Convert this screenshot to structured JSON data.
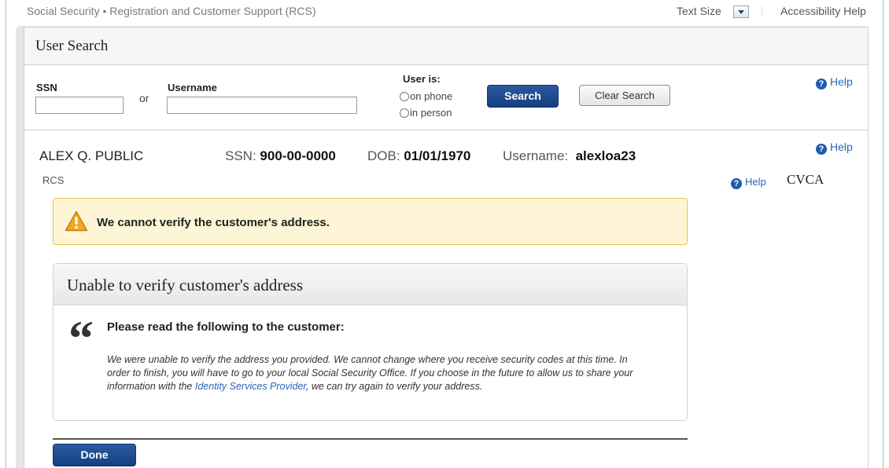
{
  "topbar": {
    "site_title": "Social Security • Registration and Customer Support (RCS)",
    "text_size_label": "Text Size",
    "accessibility_help": "Accessibility Help"
  },
  "user_search": {
    "title": "User Search",
    "ssn_label": "SSN",
    "ssn_value": "",
    "or_label": "or",
    "username_label": "Username",
    "username_value": "",
    "user_is_label": "User is:",
    "options": [
      "on phone",
      "in person"
    ],
    "search_button": "Search",
    "clear_button": "Clear Search",
    "help_label": "Help"
  },
  "customer": {
    "name": "ALEX Q. PUBLIC",
    "ssn_label": "SSN:",
    "ssn": "900-00-0000",
    "dob_label": "DOB:",
    "dob": "01/01/1970",
    "username_label": "Username:",
    "username": "alexloa23",
    "help_label": "Help"
  },
  "section": {
    "rcs_label": "RCS",
    "help_label": "Help",
    "cvca_label": "CVCA"
  },
  "alert": {
    "message": "We cannot verify the customer's address."
  },
  "panel": {
    "title": "Unable to verify customer's address",
    "quote_mark": "“",
    "read_label": "Please read the following to the customer:",
    "text_before_link": "We were unable to verify the address you provided. We cannot change where you receive security codes at this time. In order to finish, you will have to go to your local Social Security Office. If you choose in the future to allow us to share your information with the ",
    "link_text": "Identity Services Provider",
    "text_after_link": ", we can try again to verify your address."
  },
  "done_button": "Done",
  "colors": {
    "primary_button": "#1a4a8e",
    "link": "#2c64b5",
    "alert_bg": "#fdf5d6",
    "alert_border": "#e8c64a"
  }
}
